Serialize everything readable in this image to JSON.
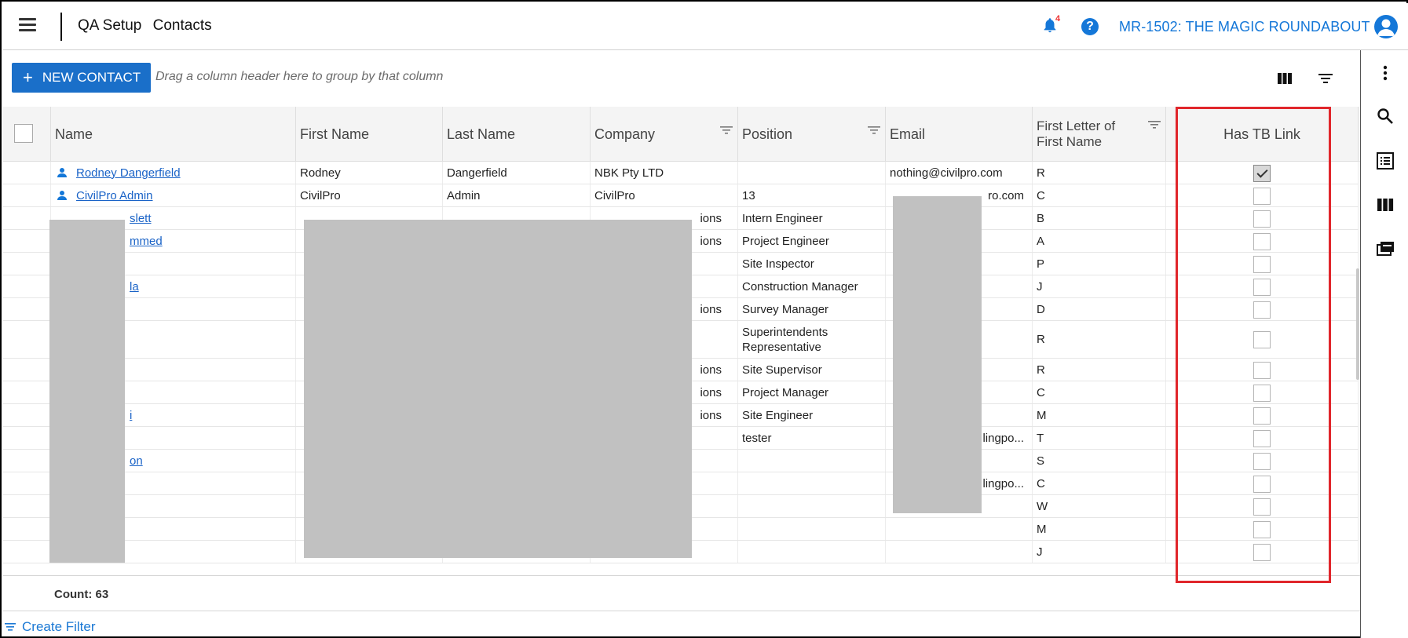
{
  "header": {
    "breadcrumbs": [
      "QA Setup",
      "Contacts"
    ],
    "notification_count": "4",
    "help_label": "?",
    "project": "MR-1502: THE MAGIC ROUNDABOUT"
  },
  "toolbar": {
    "new_contact_label": "NEW CONTACT",
    "plus": "+",
    "group_hint": "Drag a column header here to group by that column"
  },
  "columns": [
    "Name",
    "First Name",
    "Last Name",
    "Company",
    "Position",
    "Email",
    "First Letter of First Name",
    "Has TB Link"
  ],
  "rows": [
    {
      "name": "Rodney Dangerfield",
      "first": "Rodney",
      "last": "Dangerfield",
      "company": "NBK Pty LTD",
      "position": "",
      "email": "nothing@civilpro.com",
      "letter": "R",
      "tb": true
    },
    {
      "name": "CivilPro Admin",
      "first": "CivilPro",
      "last": "Admin",
      "company": "CivilPro",
      "position": "13",
      "email": "ro.com",
      "letter": "C",
      "tb": false
    },
    {
      "name": "slett",
      "first": "",
      "last": "",
      "company": "ions",
      "position": "Intern Engineer",
      "email": "",
      "letter": "B",
      "tb": false
    },
    {
      "name": "mmed",
      "first": "",
      "last": "",
      "company": "ions",
      "position": "Project Engineer",
      "email": "",
      "letter": "A",
      "tb": false
    },
    {
      "name": "",
      "first": "",
      "last": "",
      "company": "",
      "position": "Site Inspector",
      "email": "",
      "letter": "P",
      "tb": false
    },
    {
      "name": "la",
      "first": "",
      "last": "",
      "company": "",
      "position": "Construction Manager",
      "email": "",
      "letter": "J",
      "tb": false
    },
    {
      "name": "",
      "first": "",
      "last": "",
      "company": "ions",
      "position": "Survey Manager",
      "email": "",
      "letter": "D",
      "tb": false
    },
    {
      "name": "",
      "first": "",
      "last": "",
      "company": "",
      "position": "Superintendents Representative",
      "email": "",
      "letter": "R",
      "tb": false
    },
    {
      "name": "",
      "first": "",
      "last": "",
      "company": "ions",
      "position": "Site Supervisor",
      "email": "",
      "letter": "R",
      "tb": false
    },
    {
      "name": "",
      "first": "",
      "last": "",
      "company": "ions",
      "position": "Project Manager",
      "email": "",
      "letter": "C",
      "tb": false
    },
    {
      "name": "i",
      "first": "",
      "last": "",
      "company": "ions",
      "position": "Site Engineer",
      "email": "",
      "letter": "M",
      "tb": false
    },
    {
      "name": "",
      "first": "",
      "last": "",
      "company": "",
      "position": "tester",
      "email": "lingpo...",
      "letter": "T",
      "tb": false
    },
    {
      "name": "on",
      "first": "",
      "last": "",
      "company": "",
      "position": "",
      "email": "",
      "letter": "S",
      "tb": false
    },
    {
      "name": "",
      "first": "",
      "last": "",
      "company": "",
      "position": "",
      "email": "lingpo...",
      "letter": "C",
      "tb": false
    },
    {
      "name": "",
      "first": "",
      "last": "",
      "company": "",
      "position": "",
      "email": "",
      "letter": "W",
      "tb": false
    },
    {
      "name": "",
      "first": "",
      "last": "",
      "company": "",
      "position": "",
      "email": "",
      "letter": "M",
      "tb": false
    },
    {
      "name": "",
      "first": "",
      "last": "",
      "company": "",
      "position": "",
      "email": "",
      "letter": "J",
      "tb": false
    }
  ],
  "footer": {
    "count": "Count: 63",
    "create_filter": "Create Filter"
  },
  "colors": {
    "accent": "#1477d8",
    "button": "#1a6fc9",
    "highlight": "#e0262b",
    "redaction": "#c1c1c1"
  },
  "icons": [
    "menu-icon",
    "bell-icon",
    "help-icon",
    "user-avatar-icon",
    "more-vert-icon",
    "search-icon",
    "list-icon",
    "columns-icon",
    "folder-icon",
    "filter-icon",
    "person-icon"
  ]
}
